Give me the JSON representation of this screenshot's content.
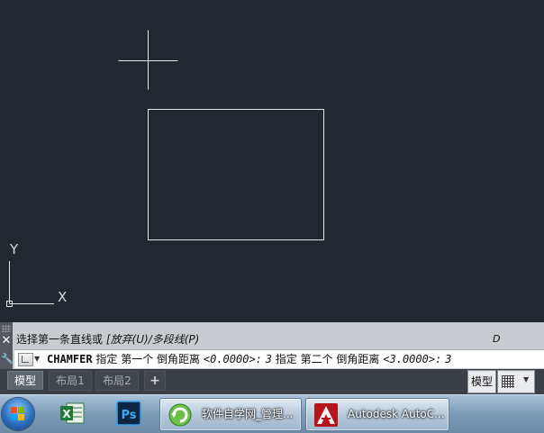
{
  "canvas": {
    "background": "#212830",
    "line_color": "#e6e6e6",
    "ucs_x_label": "X",
    "ucs_y_label": "Y"
  },
  "command": {
    "history_prefix": "选择第一条直线或",
    "history_options": "[放弃(U)/多段线(P)",
    "history_right": "D",
    "command_name": "CHAMFER",
    "input_part1": "指定 第一个 倒角距离",
    "input_default1": "<0.0000>:",
    "input_value1": "3",
    "input_part2": "指定 第二个 倒角距离",
    "input_default2": "<3.0000>:",
    "input_value2": "3",
    "close_icon": "close-icon",
    "settings_icon": "wrench-icon"
  },
  "layout_tabs": {
    "items": [
      "模型",
      "布局1",
      "布局2"
    ],
    "add_label": "+",
    "active_index": 0
  },
  "status_bar": {
    "model_label": "模型",
    "grid_icon": "grid-icon"
  },
  "taskbar": {
    "start_icon": "windows-start-icon",
    "pinned": [
      "excel-icon",
      "photoshop-icon"
    ],
    "photoshop_label": "Ps",
    "buttons": [
      {
        "label": "软件自学网_管理...",
        "icon": "browser-icon"
      },
      {
        "label": "Autodesk AutoC...",
        "icon": "autocad-icon"
      }
    ]
  },
  "annotation": {
    "arrow_color": "#e02020"
  }
}
